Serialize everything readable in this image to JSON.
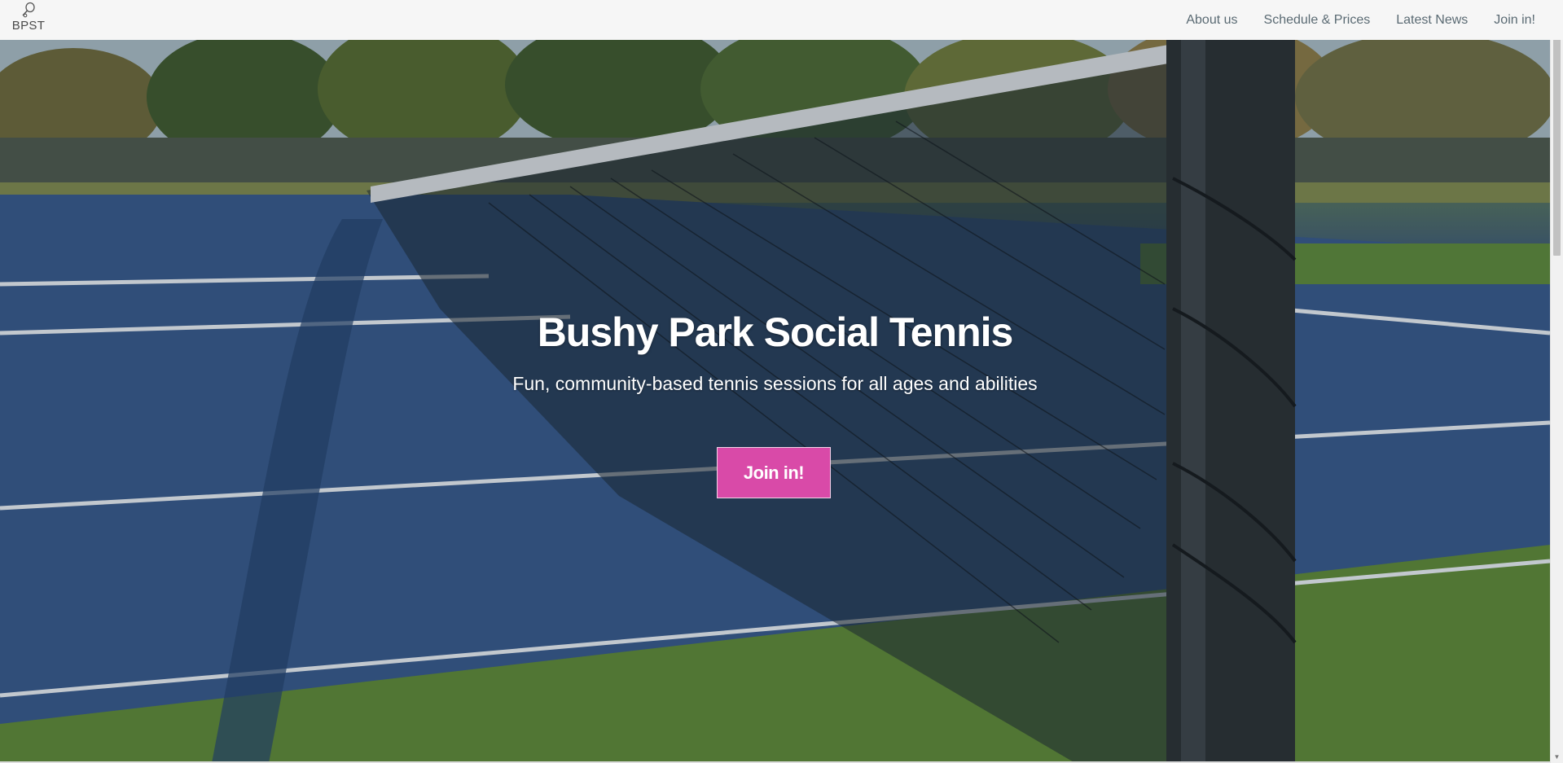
{
  "brand": {
    "text": "BPST",
    "icon": "tennis-racket-icon"
  },
  "nav": {
    "items": [
      {
        "label": "About us"
      },
      {
        "label": "Schedule & Prices"
      },
      {
        "label": "Latest News"
      },
      {
        "label": "Join in!"
      }
    ]
  },
  "hero": {
    "title": "Bushy Park Social Tennis",
    "subtitle": "Fun, community-based tennis sessions for all ages and abilities",
    "button_label": "Join in!",
    "image_subject": "tennis-court-net-photo"
  },
  "colors": {
    "accent": "#d94aa8",
    "nav_text": "#5a6a73",
    "court_blue": "#2f5485",
    "court_green": "#6b8f3a"
  }
}
